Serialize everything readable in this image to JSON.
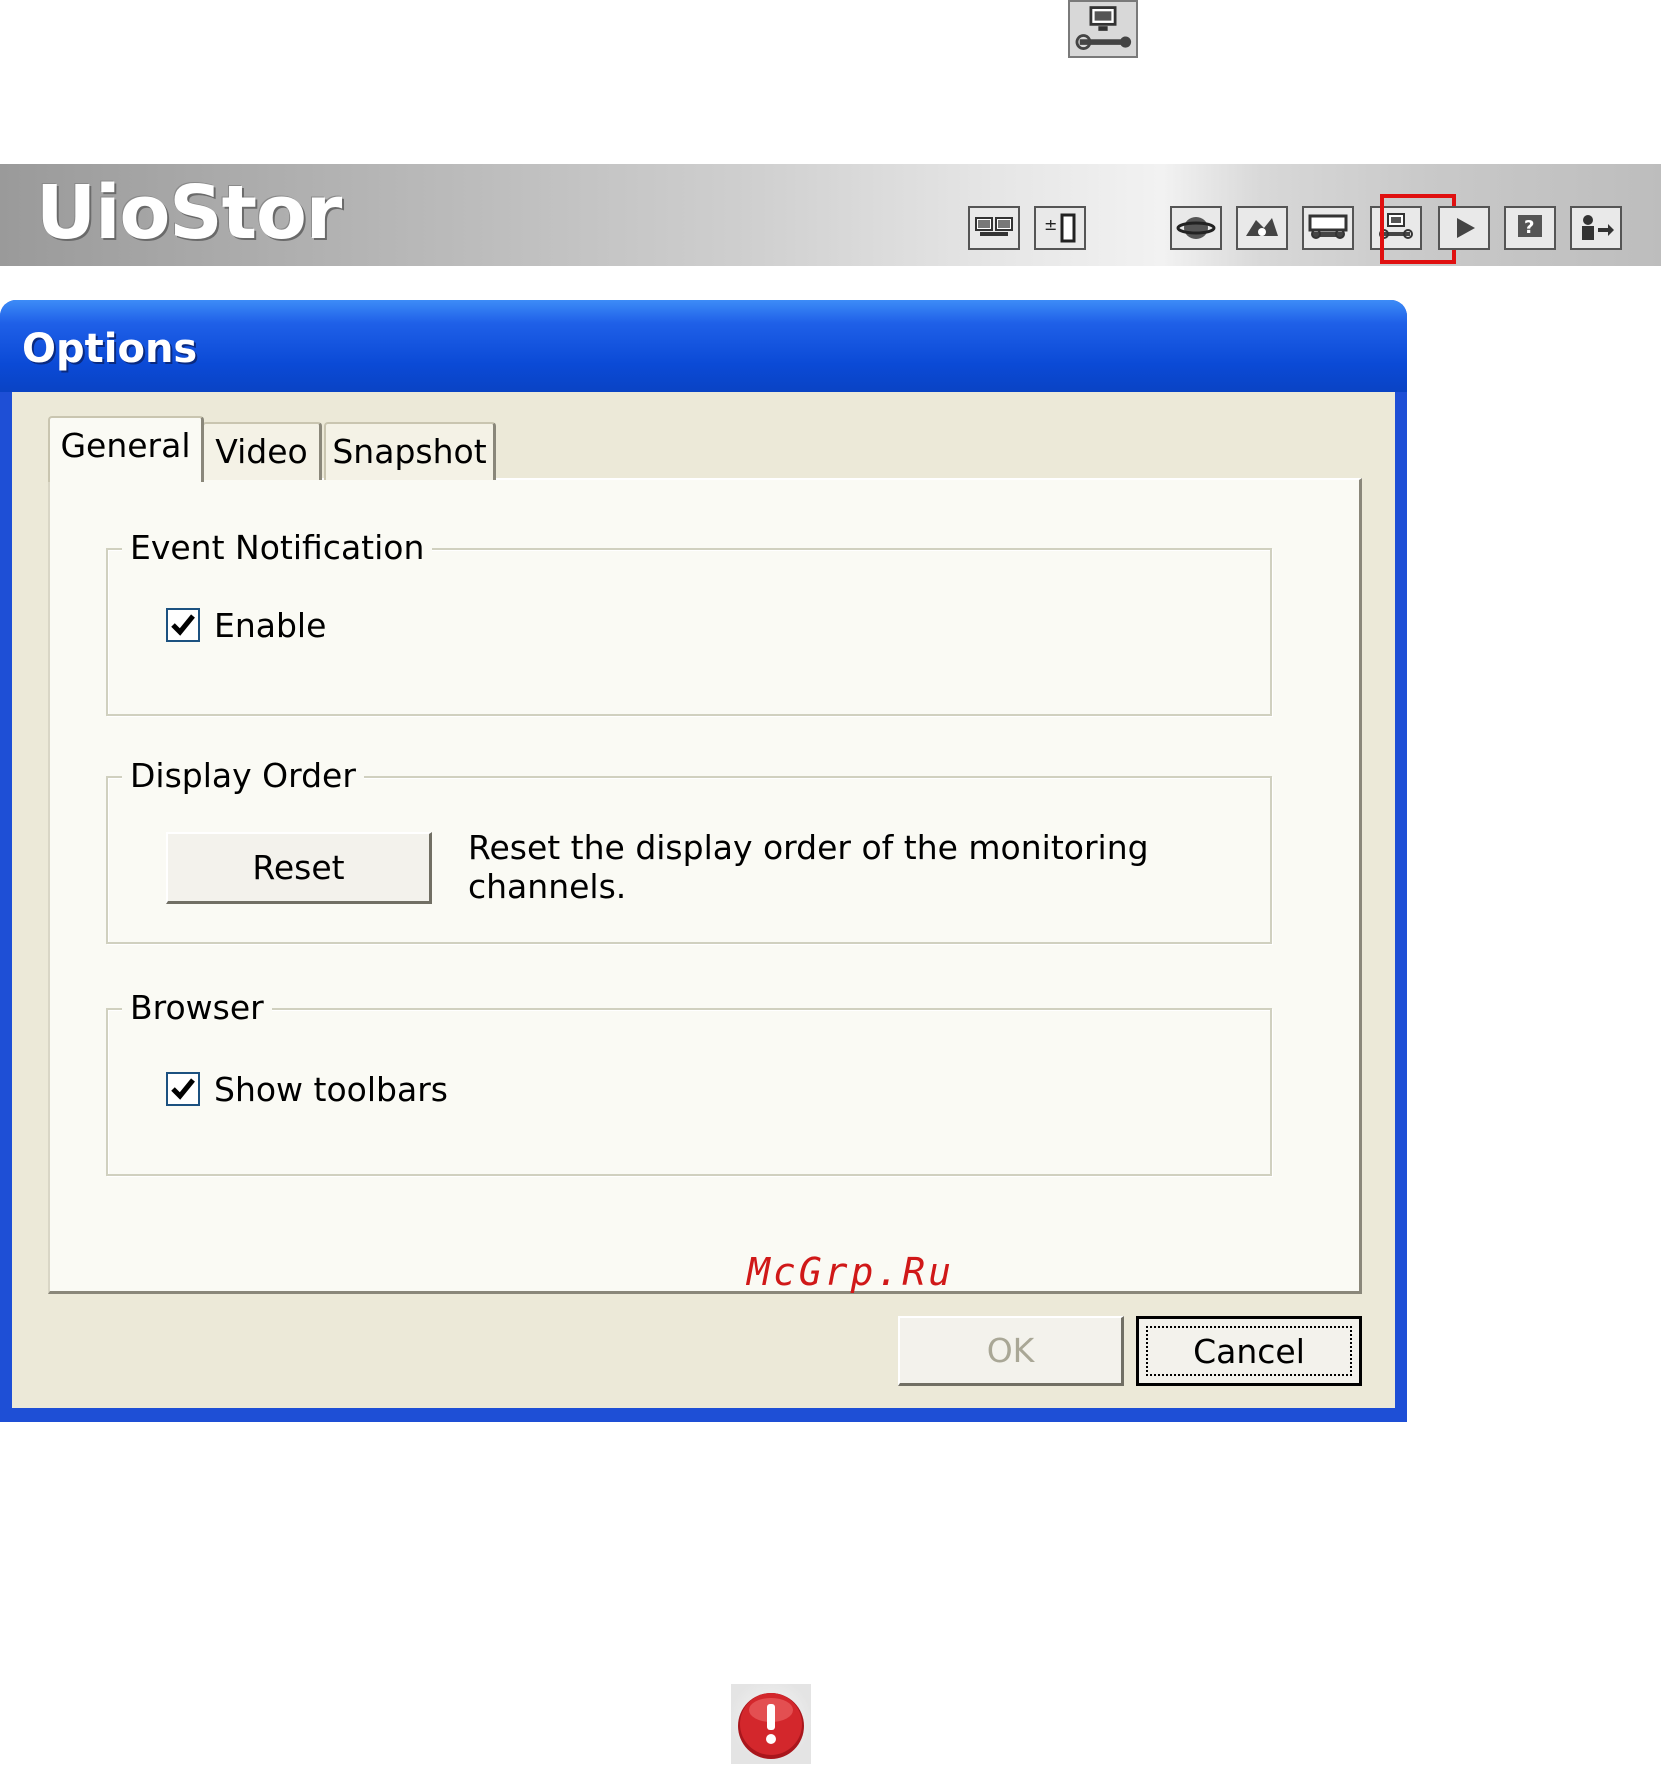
{
  "banner": {
    "brand": "UioStor",
    "toolbar_icons": [
      "multi-view-icon",
      "channel-list-icon",
      "globe-icon",
      "speedometer-icon",
      "device-settings-icon",
      "options-icon",
      "playback-icon",
      "help-icon",
      "logout-icon"
    ],
    "highlighted_icon": "options-icon"
  },
  "dialog": {
    "title": "Options",
    "tabs": [
      {
        "label": "General",
        "selected": true
      },
      {
        "label": "Video",
        "selected": false
      },
      {
        "label": "Snapshot",
        "selected": false
      }
    ],
    "event_notification": {
      "group_label": "Event Notification",
      "enable_label": "Enable",
      "enable_checked": true
    },
    "display_order": {
      "group_label": "Display Order",
      "reset_label": "Reset",
      "description": "Reset the display order of the monitoring channels."
    },
    "browser": {
      "group_label": "Browser",
      "show_toolbars_label": "Show toolbars",
      "show_toolbars_checked": true
    },
    "ok_label": "OK",
    "cancel_label": "Cancel"
  },
  "watermark": "McGrp.Ru",
  "colors": {
    "titlebar": "#0b4ad6",
    "dialog_face": "#ece9d8",
    "highlight": "#e01010",
    "watermark": "#d01818"
  }
}
